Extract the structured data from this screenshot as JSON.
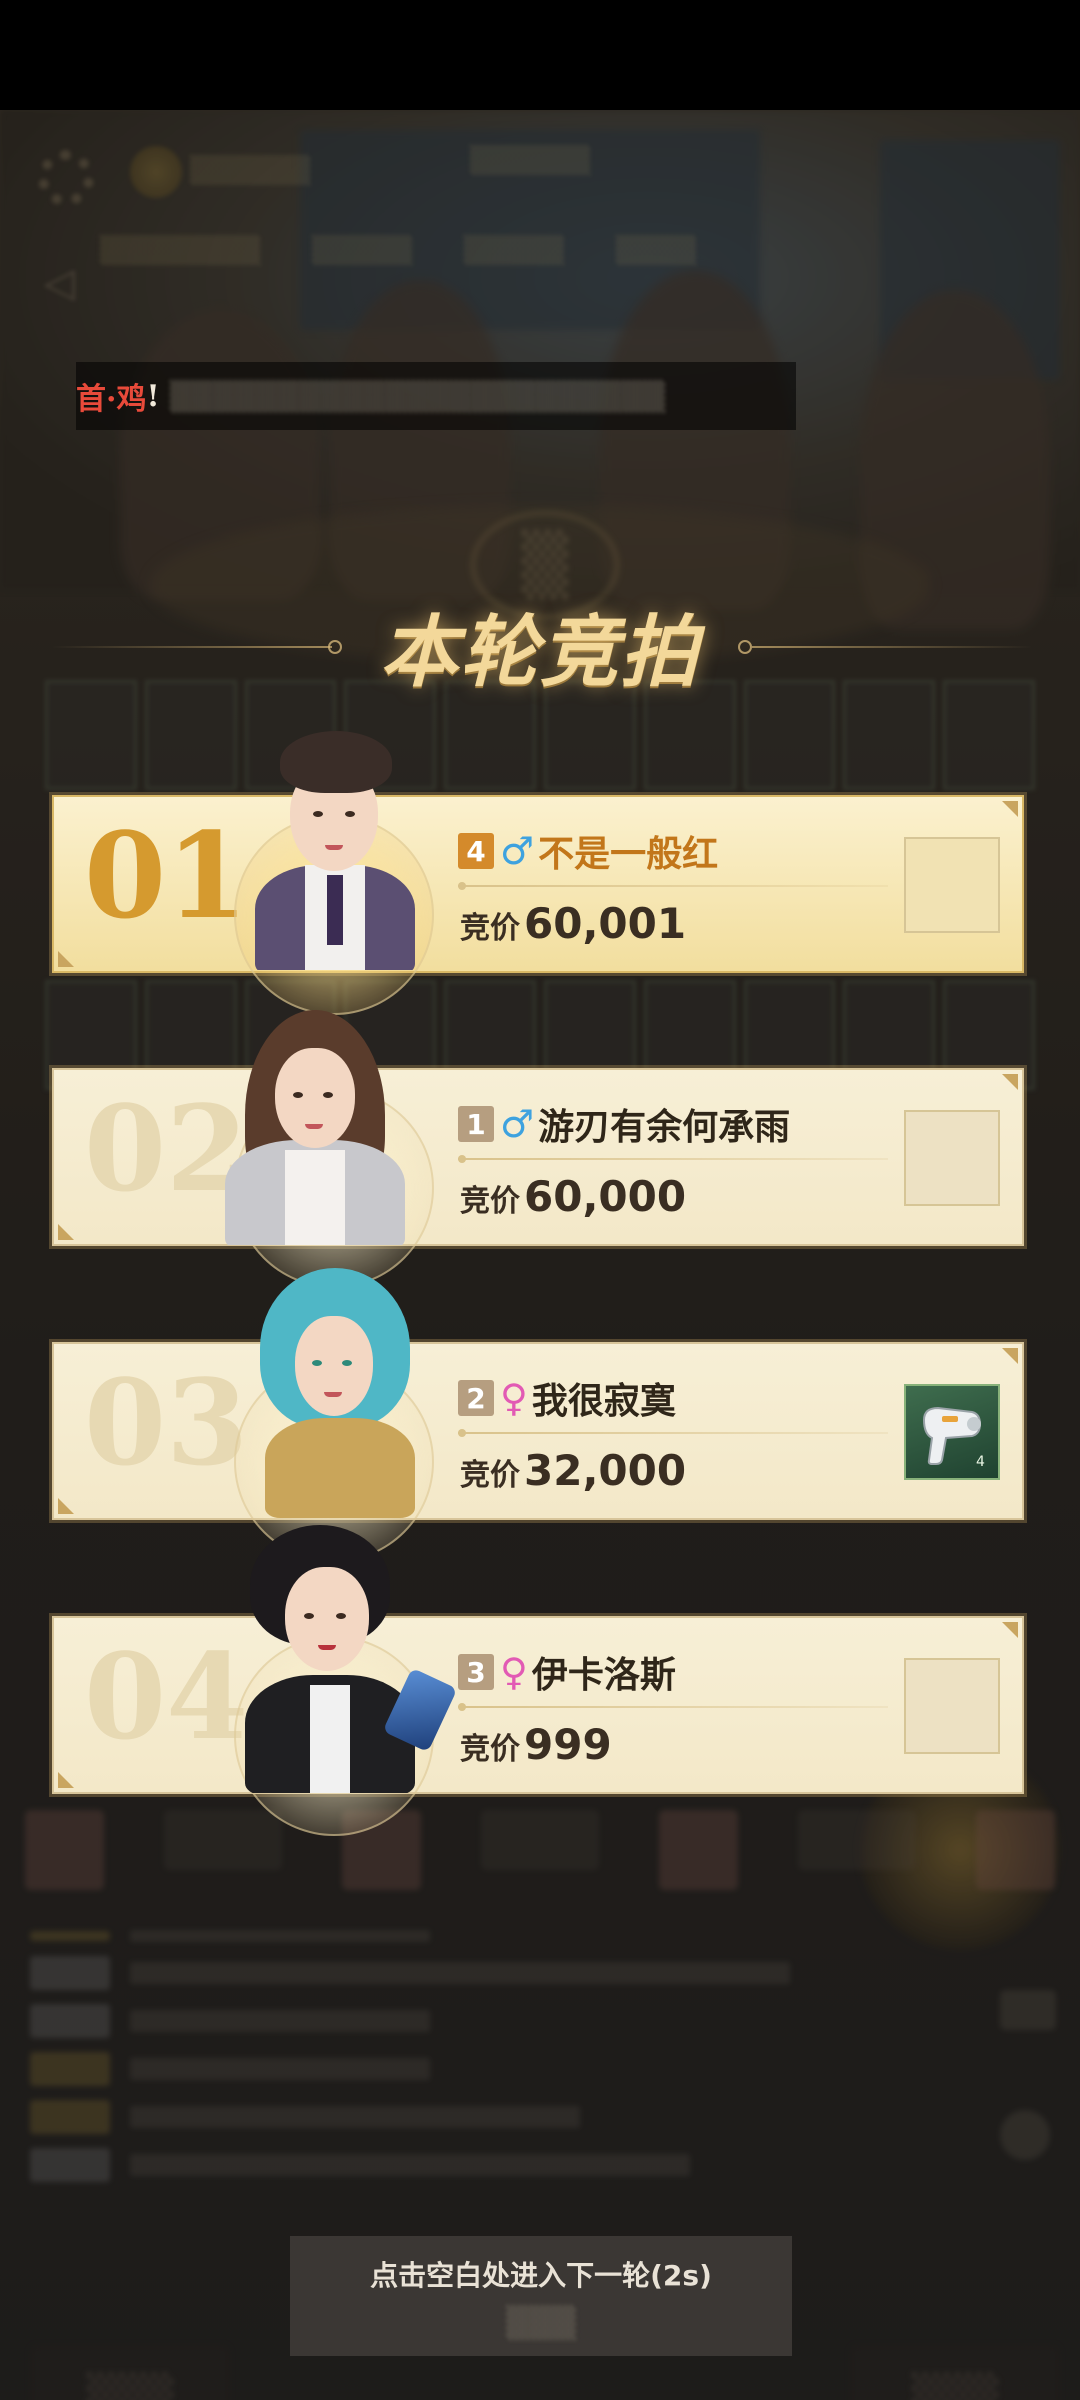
{
  "announcement": {
    "prefix_red": "首·鸡",
    "prefix_white": "!"
  },
  "round_title": "本轮竞拍",
  "bid_label": "竞价",
  "bidders": [
    {
      "rank": "01",
      "level": "4",
      "gender": "male",
      "gender_symbol": "♂",
      "name": "不是一般红",
      "bid": "60,001",
      "has_item": false
    },
    {
      "rank": "02",
      "level": "1",
      "gender": "male",
      "gender_symbol": "♂",
      "name": "游刃有余何承雨",
      "bid": "60,000",
      "has_item": false
    },
    {
      "rank": "03",
      "level": "2",
      "gender": "female",
      "gender_symbol": "♀",
      "name": "我很寂寞",
      "bid": "32,000",
      "has_item": true,
      "item_icon": "hair-dryer-icon"
    },
    {
      "rank": "04",
      "level": "3",
      "gender": "female",
      "gender_symbol": "♀",
      "name": "伊卡洛斯",
      "bid": "999",
      "has_item": false
    }
  ],
  "next_hint": "点击空白处进入下一轮(2s)",
  "colors": {
    "accent_gold": "#d59a2f",
    "title_gold": "#f3d89a",
    "male_blue": "#3ea2df",
    "female_pink": "#e25ab4",
    "announce_red": "#e84a3a"
  }
}
